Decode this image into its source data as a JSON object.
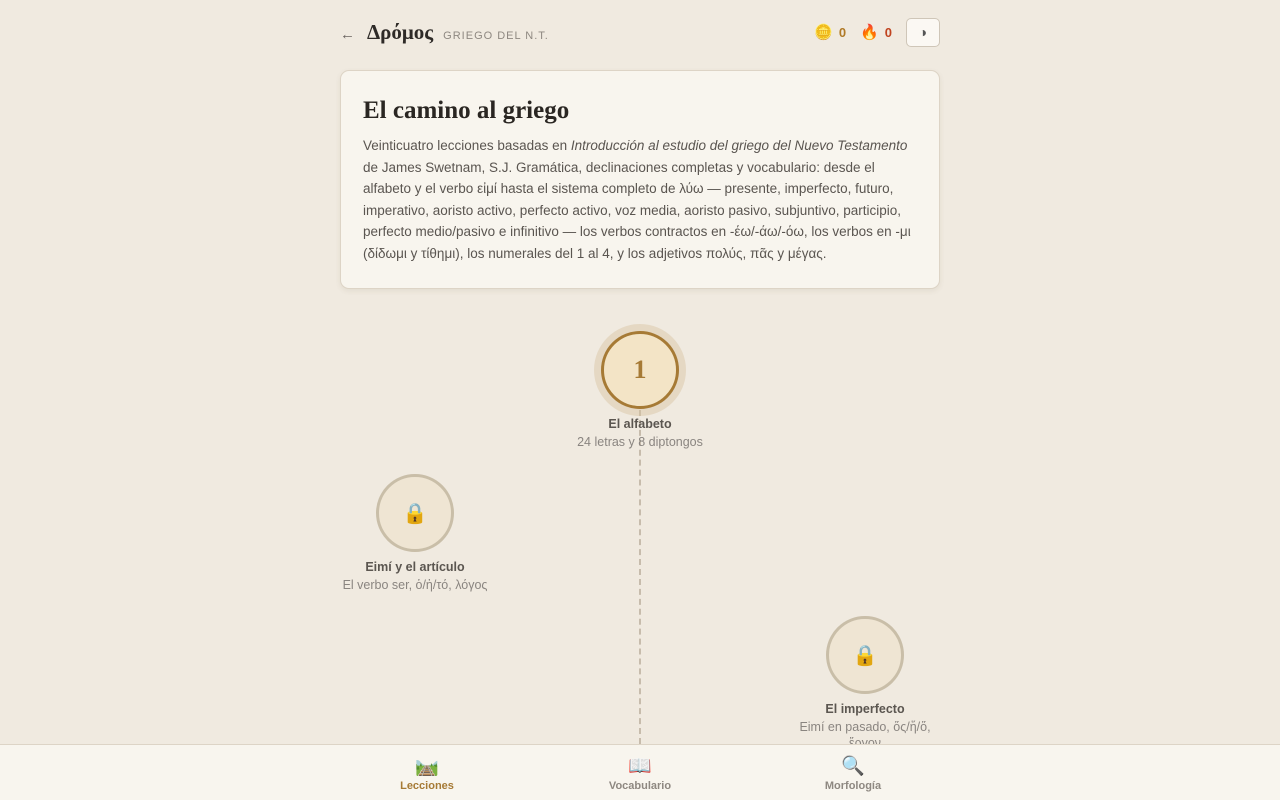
{
  "header": {
    "back_icon": "←",
    "title": "Δρόμος",
    "subtitle": "GRIEGO DEL N.T.",
    "coins": {
      "icon": "🪙",
      "value": "0"
    },
    "streak": {
      "icon": "🔥",
      "value": "0"
    },
    "theme_toggle_icon": "◑"
  },
  "intro": {
    "title": "El camino al griego",
    "text_before": "Veinticuatro lecciones basadas en ",
    "text_italic": "Introducción al estudio del griego del Nuevo Testamento",
    "text_after": " de James Swetnam, S.J. Gramática, declinaciones completas y vocabulario: desde el alfabeto y el verbo εἰμί hasta el sistema completo de λύω — presente, imperfecto, futuro, imperativo, aoristo activo, perfecto activo, voz media, aoristo pasivo, subjuntivo, participio, perfecto medio/pasivo e infinitivo — los verbos contractos en -έω/-άω/-όω, los verbos en -μι (δίδωμι y τίθημι), los numerales del 1 al 4, y los adjetivos πολύς, πᾶς y μέγας."
  },
  "lessons": [
    {
      "number": "1",
      "title": "El alfabeto",
      "subtitle": "24 letras y 8 diptongos",
      "status": "active"
    },
    {
      "icon": "🔒",
      "title": "Eimí y el artículo",
      "subtitle": "El verbo ser, ὁ/ἡ/τό, λόγος",
      "status": "locked"
    },
    {
      "icon": "🔒",
      "title": "El imperfecto",
      "subtitle": "Eimí en pasado, ὅς/ἥ/ὅ, ἔργον",
      "status": "locked"
    }
  ],
  "nav": {
    "items": [
      {
        "icon": "🛤️",
        "label": "Lecciones",
        "active": true
      },
      {
        "icon": "📖",
        "label": "Vocabulario",
        "active": false
      },
      {
        "icon": "🔍",
        "label": "Morfología",
        "active": false
      }
    ]
  },
  "colors": {
    "accent": "#a67a35",
    "background": "#f0eae0",
    "card": "#f8f5ee",
    "streak": "#c0431f"
  }
}
